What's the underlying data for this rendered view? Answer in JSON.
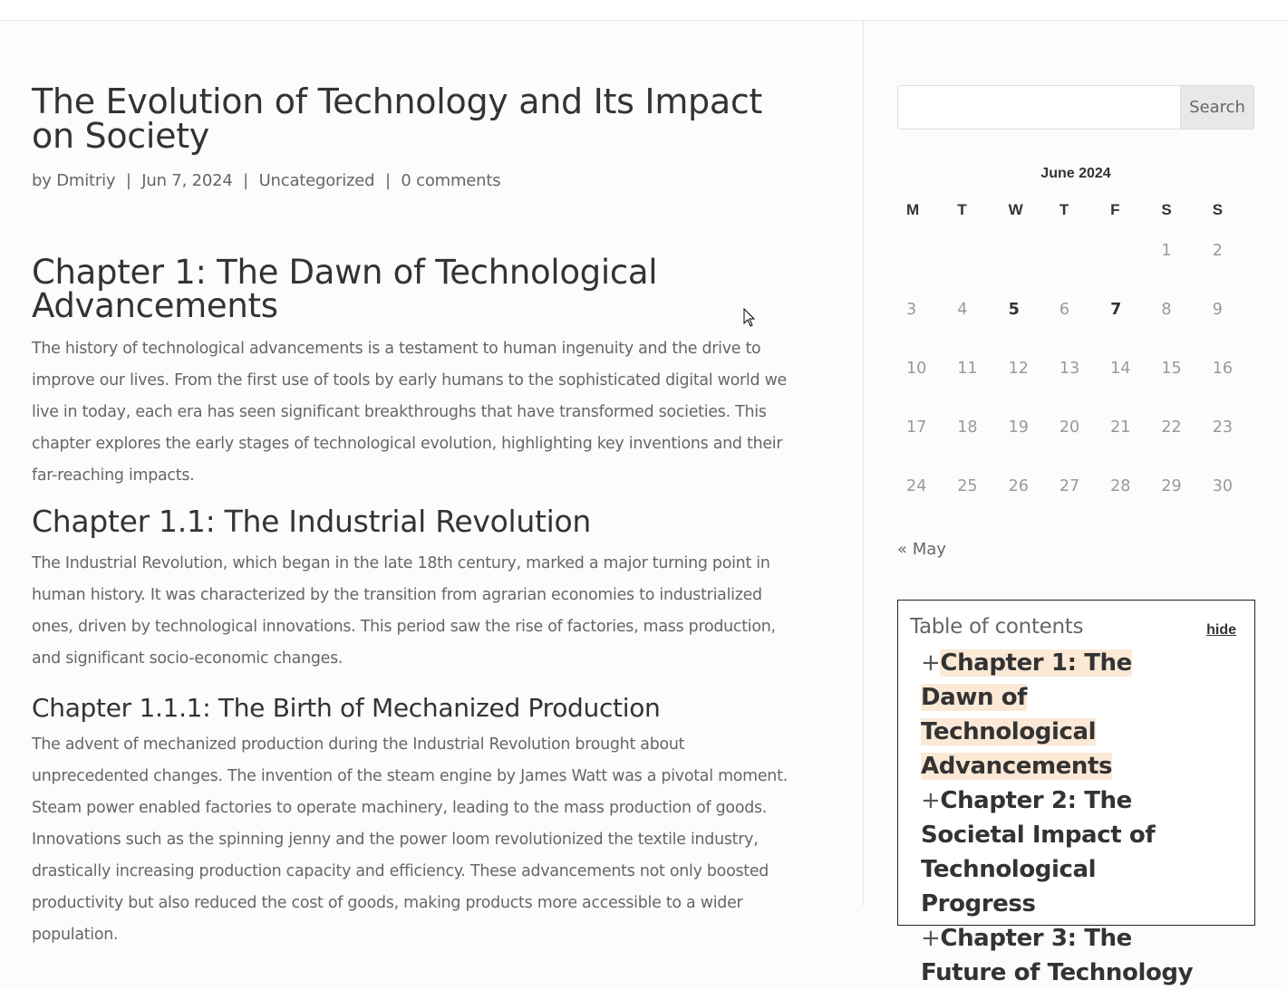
{
  "post": {
    "title": "The Evolution of Technology and Its Impact on Society",
    "meta": {
      "by": "by",
      "author": "Dmitriy",
      "date": "Jun 7, 2024",
      "category": "Uncategorized",
      "comments": "0 comments",
      "separator": "|"
    },
    "sections": {
      "ch1_heading": "Chapter 1: The Dawn of Technological Advancements",
      "ch1_text": "The history of technological advancements is a testament to human ingenuity and the drive to improve our lives. From the first use of tools by early humans to the sophisticated digital world we live in today, each era has seen significant breakthroughs that have transformed societies. This chapter explores the early stages of technological evolution, highlighting key inventions and their far-reaching impacts.",
      "ch11_heading": "Chapter 1.1: The Industrial Revolution",
      "ch11_text": "The Industrial Revolution, which began in the late 18th century, marked a major turning point in human history. It was characterized by the transition from agrarian economies to industrialized ones, driven by technological innovations. This period saw the rise of factories, mass production, and significant socio-economic changes.",
      "ch111_heading": "Chapter 1.1.1: The Birth of Mechanized Production",
      "ch111_text": "The advent of mechanized production during the Industrial Revolution brought about unprecedented changes. The invention of the steam engine by James Watt was a pivotal moment. Steam power enabled factories to operate machinery, leading to the mass production of goods. Innovations such as the spinning jenny and the power loom revolutionized the textile industry, drastically increasing production capacity and efficiency. These advancements not only boosted productivity but also reduced the cost of goods, making products more accessible to a wider population."
    }
  },
  "sidebar": {
    "search": {
      "placeholder": "",
      "button_label": "Search"
    },
    "calendar": {
      "caption": "June 2024",
      "weekdays": [
        "M",
        "T",
        "W",
        "T",
        "F",
        "S",
        "S"
      ],
      "weeks": [
        [
          "",
          "",
          "",
          "",
          "",
          "1",
          "2"
        ],
        [
          "3",
          "4",
          "5",
          "6",
          "7",
          "8",
          "9"
        ],
        [
          "10",
          "11",
          "12",
          "13",
          "14",
          "15",
          "16"
        ],
        [
          "17",
          "18",
          "19",
          "20",
          "21",
          "22",
          "23"
        ],
        [
          "24",
          "25",
          "26",
          "27",
          "28",
          "29",
          "30"
        ]
      ],
      "linked_days": [
        "5",
        "7"
      ],
      "prev_label": "« May"
    },
    "toc": {
      "title": "Table of contents",
      "hide_label": "hide",
      "items": [
        {
          "plus": "+",
          "label": "Chapter 1: The Dawn of Technological Advancements",
          "active": true
        },
        {
          "plus": "+",
          "label": "Chapter 2: The Societal Impact of Technological Progress",
          "active": false
        },
        {
          "plus": "+",
          "label": "Chapter 3: The Future of Technology",
          "active": false
        }
      ],
      "highlight_color": "#fbe9d6"
    }
  }
}
